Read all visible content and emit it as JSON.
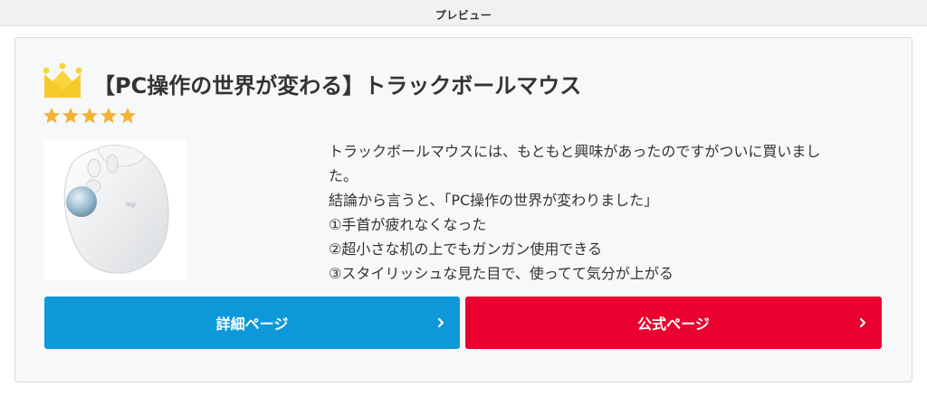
{
  "header": {
    "title": "プレビュー"
  },
  "card": {
    "title": "【PC操作の世界が変わる】トラックボールマウス",
    "rating": 5,
    "description_lines": [
      "トラックボールマウスには、もともと興味があったのですがついに買いまし",
      "た。",
      "結論から言うと、「PC操作の世界が変わりました」",
      "①手首が疲れなくなった",
      "②超小さな机の上でもガンガン使用できる",
      "③スタイリッシュな見た目で、使ってて気分が上がる"
    ],
    "buttons": {
      "detail_label": "詳細ページ",
      "official_label": "公式ページ"
    }
  },
  "colors": {
    "detail_button": "#0e98d8",
    "official_button": "#e9022f",
    "star": "#f5b335",
    "crown": "#f7d53a"
  },
  "icons": [
    "crown-icon",
    "star-icon",
    "chevron-right-icon"
  ]
}
